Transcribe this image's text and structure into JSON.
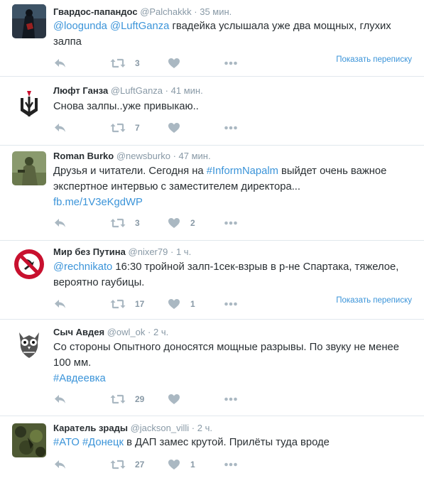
{
  "icons": {
    "reply": "reply-icon",
    "retweet": "retweet-icon",
    "like": "heart-icon",
    "more": "more-icon"
  },
  "colors": {
    "link": "#3b94d9",
    "muted": "#8899a6",
    "text": "#292f33",
    "border": "#e1e8ed",
    "accent": "#19cf86"
  },
  "show_conversation": "Показать переписку",
  "tweets": [
    {
      "name": "Гвардос-папандос",
      "handle": "@Palchakkk",
      "dot": "·",
      "time": "35 мин.",
      "mentions": [
        "@loogunda",
        "@LuftGanza"
      ],
      "text": "гвадейка услышала уже два мощных, глухих залпа",
      "retweets": "3",
      "likes": ""
    },
    {
      "name": "Люфт Ганза",
      "handle": "@LuftGanza",
      "dot": "·",
      "time": "41 мин.",
      "text": "Снова залпы..уже привыкаю..",
      "retweets": "7",
      "likes": ""
    },
    {
      "name": "Roman Burko",
      "handle": "@newsburko",
      "dot": "·",
      "time": "47 мин.",
      "text_pre": "Друзья и читатели. Сегодня на ",
      "hashtag": "#InformNapalm",
      "text_post": " выйдет очень важное экспертное интервью с заместителем директора...",
      "link": "fb.me/1V3eKgdWP",
      "retweets": "3",
      "likes": "2"
    },
    {
      "name": "Мир без Путина",
      "handle": "@nixer79",
      "dot": "·",
      "time": "1 ч.",
      "mention": "@rechnikato",
      "text": " 16:30 тройной залп-1сек-взрыв в р-не Спартака, тяжелое, вероятно гаубицы.",
      "retweets": "17",
      "likes": "1"
    },
    {
      "name": "Сыч Авдея",
      "handle": "@owl_ok",
      "dot": "·",
      "time": "2 ч.",
      "text": "Со стороны  Опытного доносятся мощные разрывы. По звуку не менее 100 мм.",
      "hashtag": "#Авдеевка",
      "retweets": "29",
      "likes": ""
    },
    {
      "name": "Каратель зрады",
      "handle": "@jackson_villi",
      "dot": "·",
      "time": "2 ч.",
      "hashtags": [
        "#АТО",
        "#Донецк"
      ],
      "text": " в ДАП замес крутой. Прилёты туда вроде",
      "retweets": "27",
      "likes": "1"
    }
  ]
}
